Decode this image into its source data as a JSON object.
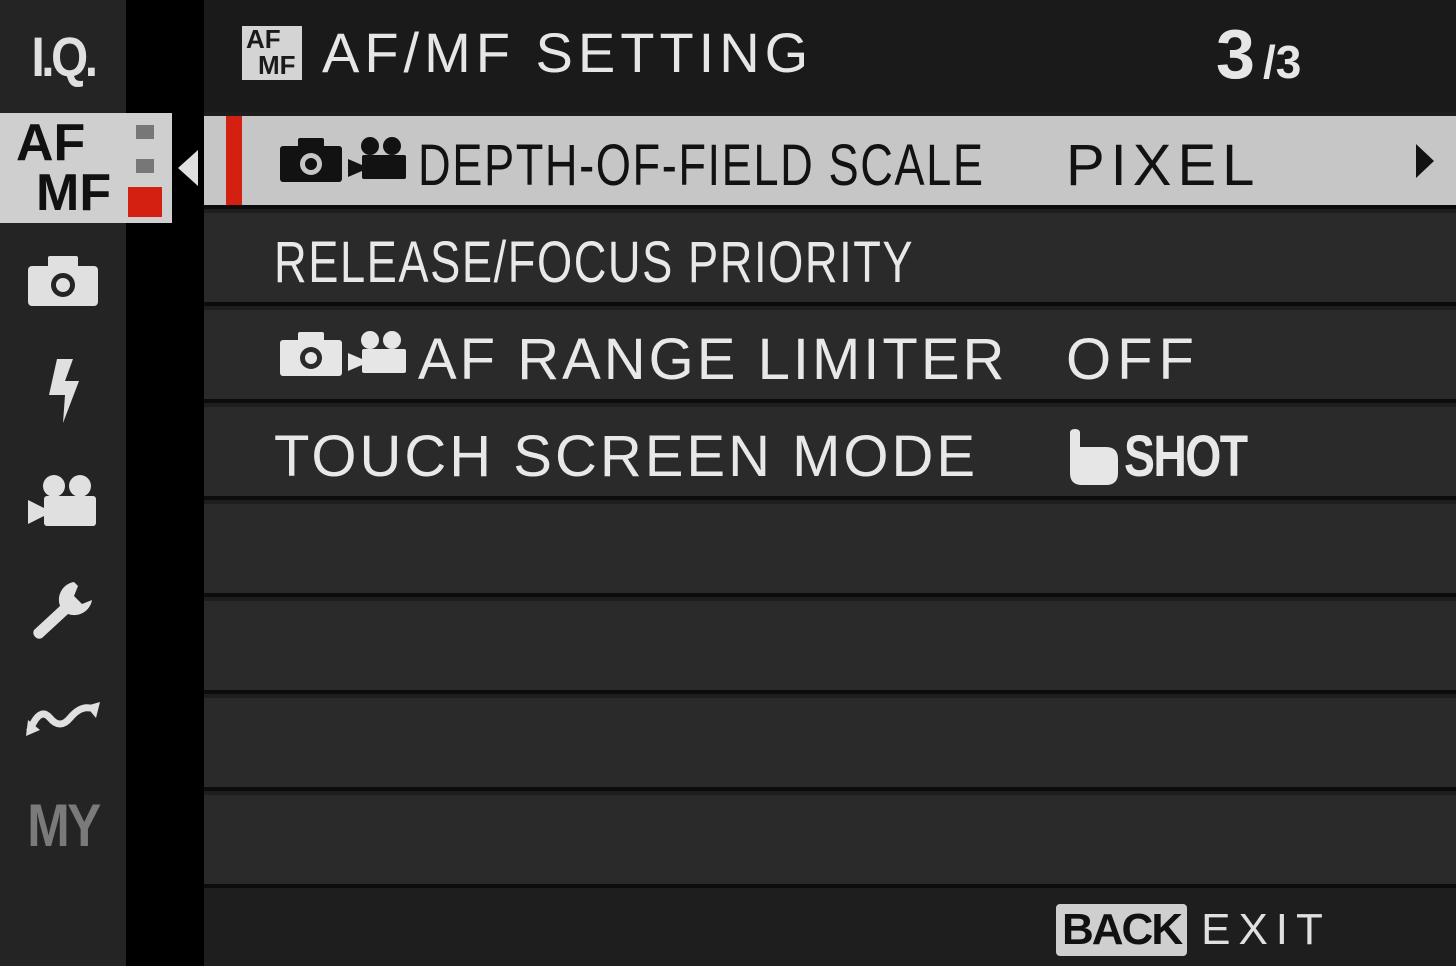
{
  "sidebar": {
    "items": [
      {
        "name": "iq",
        "label": "I.Q."
      },
      {
        "name": "af-mf",
        "label_af": "AF",
        "label_mf": "MF",
        "active": true
      },
      {
        "name": "shooting",
        "icon": "camera-icon"
      },
      {
        "name": "flash",
        "icon": "flash-icon"
      },
      {
        "name": "movie",
        "icon": "movie-camera-icon"
      },
      {
        "name": "setup",
        "icon": "wrench-icon"
      },
      {
        "name": "connection",
        "icon": "connection-wave-icon"
      },
      {
        "name": "my-menu",
        "label": "MY"
      }
    ]
  },
  "header": {
    "icon_af": "AF",
    "icon_mf": "MF",
    "title": "AF/MF SETTING",
    "page_current": "3",
    "page_total": "/3"
  },
  "rows": [
    {
      "label": "DEPTH-OF-FIELD SCALE",
      "value": "PIXEL",
      "selected": true,
      "icons": [
        "camera-icon",
        "movie-camera-icon"
      ]
    },
    {
      "label": "RELEASE/FOCUS PRIORITY",
      "value": ""
    },
    {
      "label": "AF RANGE LIMITER",
      "value": "OFF",
      "icons": [
        "camera-icon",
        "movie-camera-icon"
      ]
    },
    {
      "label": "TOUCH SCREEN MODE",
      "value": "SHOT",
      "value_icon": "touch-hand-icon"
    }
  ],
  "footer": {
    "back_key": "BACK",
    "exit_label": "EXIT"
  },
  "colors": {
    "accent_red": "#d42010",
    "selected_row": "#c6c6c6",
    "row_bg": "#2a2a2a",
    "sidebar_bg": "#242424"
  }
}
